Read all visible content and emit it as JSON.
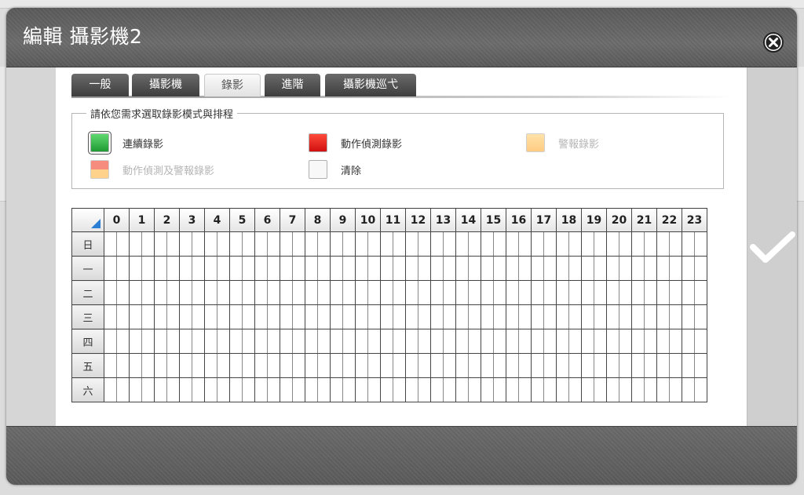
{
  "dialog": {
    "title": "編輯 攝影機2"
  },
  "tabs": [
    {
      "label": "一般",
      "active": false
    },
    {
      "label": "攝影機",
      "active": false
    },
    {
      "label": "錄影",
      "active": true
    },
    {
      "label": "進階",
      "active": false
    },
    {
      "label": "攝影機巡弋",
      "active": false
    }
  ],
  "recording_modes": {
    "legend": "請依您需求選取錄影模式與排程",
    "items": [
      {
        "label": "連續錄影",
        "color": "#2fb84a",
        "selected": true,
        "enabled": true
      },
      {
        "label": "動作偵測錄影",
        "color": "#e8231c",
        "selected": false,
        "enabled": true
      },
      {
        "label": "警報錄影",
        "color": "#ffbe4a",
        "selected": false,
        "enabled": false
      },
      {
        "label": "動作偵測及警報錄影",
        "color": "split-red-orange",
        "selected": false,
        "enabled": false
      },
      {
        "label": "清除",
        "color": "#f8f8f8",
        "selected": false,
        "enabled": true
      }
    ]
  },
  "schedule": {
    "hours": [
      "0",
      "1",
      "2",
      "3",
      "4",
      "5",
      "6",
      "7",
      "8",
      "9",
      "10",
      "11",
      "12",
      "13",
      "14",
      "15",
      "16",
      "17",
      "18",
      "19",
      "20",
      "21",
      "22",
      "23"
    ],
    "days": [
      "日",
      "一",
      "二",
      "三",
      "四",
      "五",
      "六"
    ]
  },
  "icons": {
    "close": "close-icon",
    "confirm": "checkmark-icon",
    "corner": "select-all-triangle-icon"
  },
  "colors": {
    "header_bg": "#5f5f5f",
    "accent_blue": "#2a7fd4"
  }
}
